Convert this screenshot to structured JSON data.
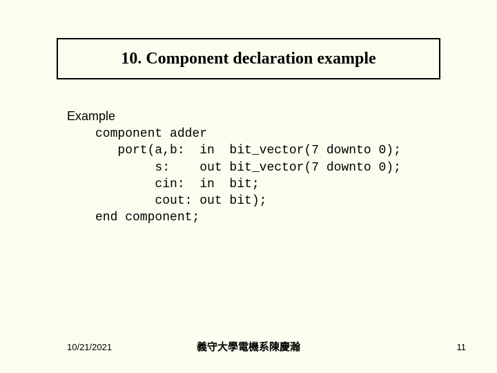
{
  "title": "10. Component declaration example",
  "example_label": "Example",
  "code": "component adder\n   port(a,b:  in  bit_vector(7 downto 0);\n        s:    out bit_vector(7 downto 0);\n        cin:  in  bit;\n        cout: out bit);\nend component;",
  "footer": {
    "date": "10/21/2021",
    "center": "義守大學電機系陳慶瀚",
    "page": "11"
  }
}
